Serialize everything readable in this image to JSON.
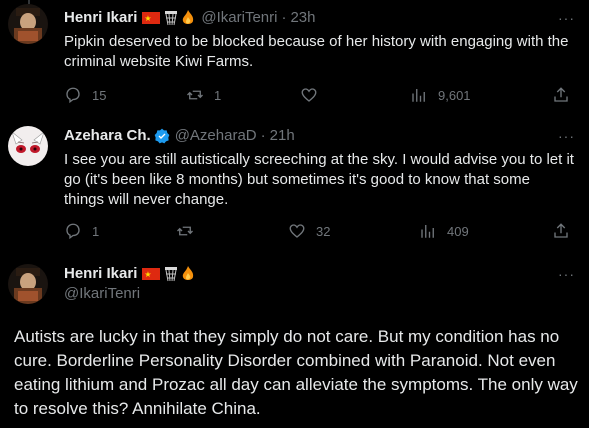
{
  "tweets": [
    {
      "name": "Henri Ikari",
      "handle": "@IkariTenri",
      "separator": "·",
      "time": "23h",
      "text": "Pipkin deserved to be blocked because of her history with engaging with the criminal website Kiwi Farms.",
      "replies": "15",
      "retweets": "1",
      "likes": "",
      "views": "9,601"
    },
    {
      "name": "Azehara Ch.",
      "handle": "@AzeharaD",
      "separator": "·",
      "time": "21h",
      "text": "I see you are still autistically screeching at the sky.  I would advise you to let it go (it's been like 8 months) but sometimes it's good to know that some things will never change.",
      "replies": "1",
      "retweets": "",
      "likes": "32",
      "views": "409"
    },
    {
      "name": "Henri Ikari",
      "handle": "@IkariTenri",
      "text": "Autists are lucky in that they simply do not care. But my condition has no cure. Borderline Personality Disorder combined with Paranoid. Not even eating lithium and Prozac all day can alleviate the symptoms. The only way to resolve this? Annihilate China."
    }
  ],
  "more_label": "···",
  "colors": {
    "background": "#000000",
    "text": "#e7e9ea",
    "muted": "#71767b",
    "verified": "#1d9bf0"
  },
  "icons": [
    "reply-icon",
    "retweet-icon",
    "like-icon",
    "views-icon",
    "share-icon",
    "verified-icon",
    "china-flag-icon",
    "basketball-hoop-icon",
    "fire-icon"
  ]
}
